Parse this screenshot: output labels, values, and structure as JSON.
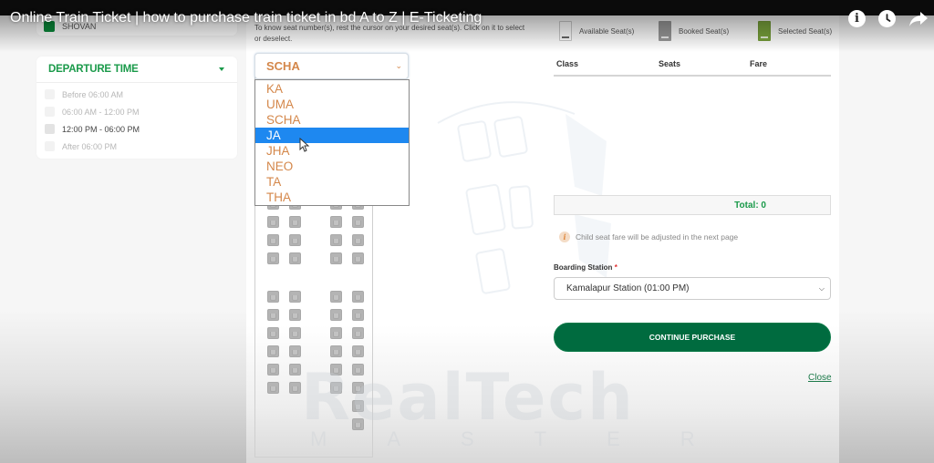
{
  "video": {
    "title": "Online Train Ticket | how to purchase train ticket in bd A to Z | E-Ticketing",
    "icons": [
      "info-icon",
      "watch-later-icon",
      "share-icon"
    ]
  },
  "sidebar": {
    "operator": {
      "label": "SHOVAN",
      "color": "#0a8a3a"
    },
    "departure_time": {
      "title": "DEPARTURE TIME",
      "options": [
        {
          "label": "Before 06:00 AM",
          "enabled": false
        },
        {
          "label": "06:00 AM - 12:00 PM",
          "enabled": false
        },
        {
          "label": "12:00 PM - 06:00 PM",
          "enabled": true
        },
        {
          "label": "After 06:00 PM",
          "enabled": false
        }
      ]
    }
  },
  "seat_selection": {
    "hint": "To know seat number(s), rest the cursor on your desired seat(s). Click on it to select or deselect.",
    "coach_select": {
      "selected": "SCHA",
      "options": [
        "KA",
        "UMA",
        "SCHA",
        "JA",
        "JHA",
        "NEO",
        "TA",
        "THA"
      ],
      "highlighted": "JA"
    },
    "seat_status": "booked"
  },
  "legend": {
    "available": "Available Seat(s)",
    "booked": "Booked Seat(s)",
    "selected": "Selected Seat(s)"
  },
  "fare_table": {
    "columns": [
      "Class",
      "Seats",
      "Fare"
    ],
    "rows": [],
    "total": "Total: 0"
  },
  "child_note": "Child seat fare will be adjusted in the next page",
  "boarding": {
    "label": "Boarding Station",
    "required_mark": "*",
    "value": "Kamalapur Station (01:00 PM)"
  },
  "actions": {
    "continue": "CONTINUE PURCHASE",
    "close": "Close"
  },
  "watermark": {
    "main": "RealTech",
    "sub": "MASTER"
  },
  "colors": {
    "brand_green": "#006b3f",
    "accent_green": "#1a9a4a",
    "coach_text": "#d4874a",
    "highlight_blue": "#1e88f0"
  }
}
